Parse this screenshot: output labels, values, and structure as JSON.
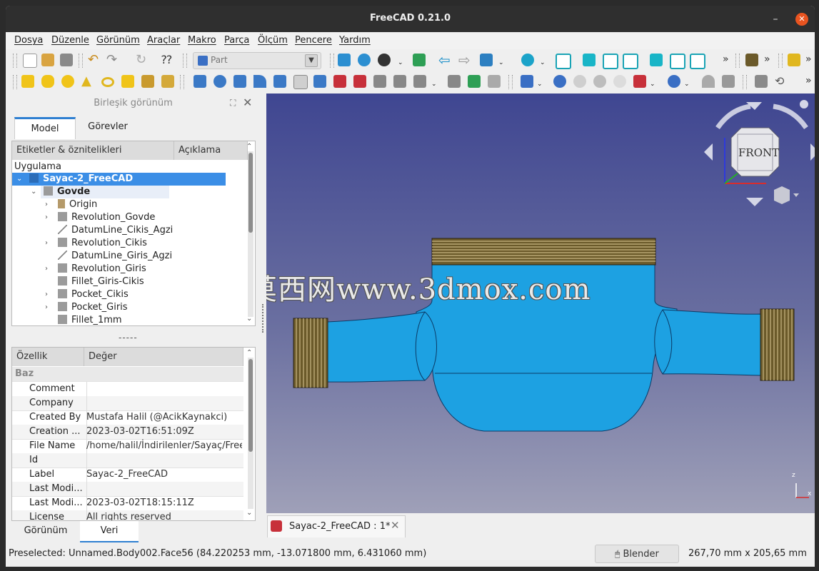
{
  "window": {
    "title": "FreeCAD 0.21.0"
  },
  "menu": [
    "Dosya",
    "Düzenle",
    "Görünüm",
    "Araçlar",
    "Makro",
    "Parça",
    "Ölçüm",
    "Pencere",
    "Yardım"
  ],
  "toolbar": {
    "workbench": "Part",
    "more": "»"
  },
  "combo_view": {
    "title": "Birleşik görünüm",
    "tabs": [
      "Model",
      "Görevler"
    ],
    "tree_headers": [
      "Etiketler & öznitelikleri",
      "Açıklama"
    ],
    "root_label": "Uygulama",
    "document": "Sayac-2_FreeCAD",
    "body": "Govde",
    "items": [
      "Origin",
      "Revolution_Govde",
      "DatumLine_Cikis_Agzi",
      "Revolution_Cikis",
      "DatumLine_Giris_Agzi",
      "Revolution_Giris",
      "Fillet_Giris-Cikis",
      "Pocket_Cikis",
      "Pocket_Giris",
      "Fillet_1mm"
    ],
    "splitter": "-----"
  },
  "properties": {
    "headers": [
      "Özellik",
      "Değer"
    ],
    "group": "Baz",
    "rows": [
      {
        "k": "Comment",
        "v": ""
      },
      {
        "k": "Company",
        "v": ""
      },
      {
        "k": "Created By",
        "v": "Mustafa Halil (@AcikKaynakci)"
      },
      {
        "k": "Creation ...",
        "v": "2023-03-02T16:51:09Z"
      },
      {
        "k": "File Name",
        "v": "/home/halil/İndirilenler/Sayaç/Free..."
      },
      {
        "k": "Id",
        "v": ""
      },
      {
        "k": "Label",
        "v": "Sayac-2_FreeCAD"
      },
      {
        "k": "Last Modi...",
        "v": ""
      },
      {
        "k": "Last Modi...",
        "v": "2023-03-02T18:15:11Z"
      },
      {
        "k": "License",
        "v": "All rights reserved"
      }
    ],
    "bottom_tabs": [
      "Görünüm",
      "Veri"
    ]
  },
  "viewport": {
    "navcube_face": "FRONT",
    "watermark": "莫西网www.3dmox.com",
    "doc_tab": "Sayac-2_FreeCAD : 1*",
    "axis_z": "z",
    "axis_x": "x",
    "colors": {
      "part": "#1da1e2",
      "thread": "#6b5a2a",
      "bg_top": "#3f4691",
      "bg_bottom": "#9fa0b8"
    }
  },
  "status": {
    "preselected": "Preselected: Unnamed.Body002.Face56 (84.220253 mm, -13.071800 mm, 6.431060 mm)",
    "nav_style": "Blender",
    "dimensions": "267,70 mm x 205,65 mm"
  }
}
